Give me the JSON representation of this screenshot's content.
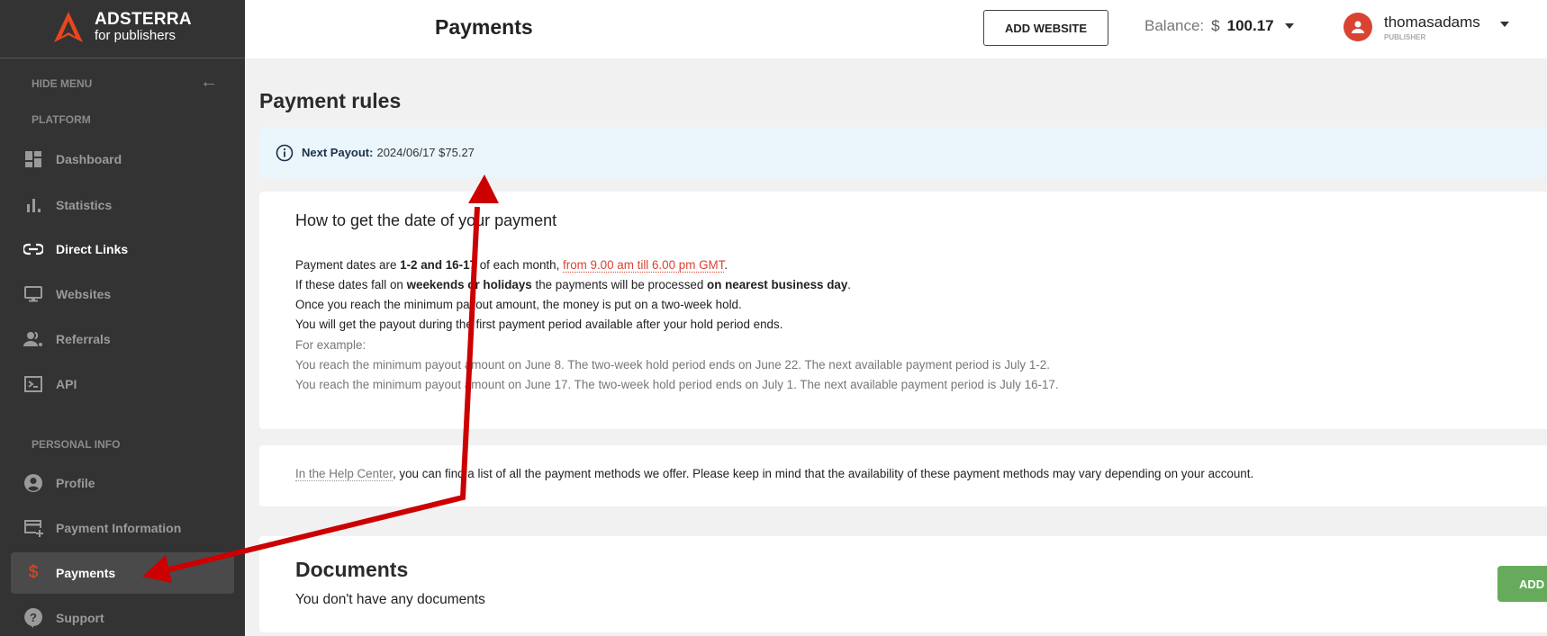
{
  "brand": {
    "name": "ADSTERRA",
    "tagline": "for publishers",
    "accent": "#e8461e"
  },
  "sidebar": {
    "hide_menu": "HIDE MENU",
    "sections": {
      "platform": "PLATFORM",
      "personal": "PERSONAL INFO"
    },
    "items": [
      {
        "label": "Dashboard",
        "icon": "dashboard-icon"
      },
      {
        "label": "Statistics",
        "icon": "bar-chart-icon"
      },
      {
        "label": "Direct Links",
        "icon": "link-icon"
      },
      {
        "label": "Websites",
        "icon": "monitor-icon"
      },
      {
        "label": "Referrals",
        "icon": "people-icon"
      },
      {
        "label": "API",
        "icon": "terminal-icon"
      },
      {
        "label": "Profile",
        "icon": "account-circle-icon"
      },
      {
        "label": "Payment Information",
        "icon": "card-add-icon"
      },
      {
        "label": "Payments",
        "icon": "dollar-icon",
        "active": true
      },
      {
        "label": "Support",
        "icon": "help-icon"
      }
    ]
  },
  "header": {
    "title": "Payments",
    "add_website": "ADD WEBSITE",
    "balance_label": "Balance:",
    "balance_currency": "$",
    "balance_value": "100.17",
    "user_name": "thomasadams",
    "user_role": "PUBLISHER"
  },
  "main": {
    "rules_title": "Payment rules",
    "next_payout_label": "Next Payout:",
    "next_payout_value": "2024/06/17 $75.27",
    "how_title": "How to get the date of your payment",
    "rules": {
      "l1_a": "Payment dates are ",
      "l1_b": "1-2 and 16-17",
      "l1_c": " of each month, ",
      "l1_link": "from 9.00 am till 6.00 pm GMT",
      "l1_d": ".",
      "l2_a": "If these dates fall on ",
      "l2_b": "weekends or holidays",
      "l2_c": " the payments will be processed ",
      "l2_d": "on nearest business day",
      "l2_e": ".",
      "l3": "Once you reach the minimum payout amount, the money is put on a two-week hold.",
      "l4": "You will get the payout during the first payment period available after your hold period ends."
    },
    "examples": {
      "title": "For example:",
      "e1": "You reach the minimum payout amount on June 8. The two-week hold period ends on June 22. The next available payment period is July 1-2.",
      "e2": "You reach the minimum payout amount on June 17. The two-week hold period ends on July 1. The next available payment period is July 16-17."
    },
    "help_link": "In the Help Center",
    "help_text": ", you can find a list of all the payment methods we offer. Please keep in mind that the availability of these payment methods may vary depending on your account.",
    "documents_title": "Documents",
    "documents_empty": "You don't have any documents",
    "add_new": "ADD NEW"
  },
  "annotation": {
    "color": "#cc0000"
  }
}
